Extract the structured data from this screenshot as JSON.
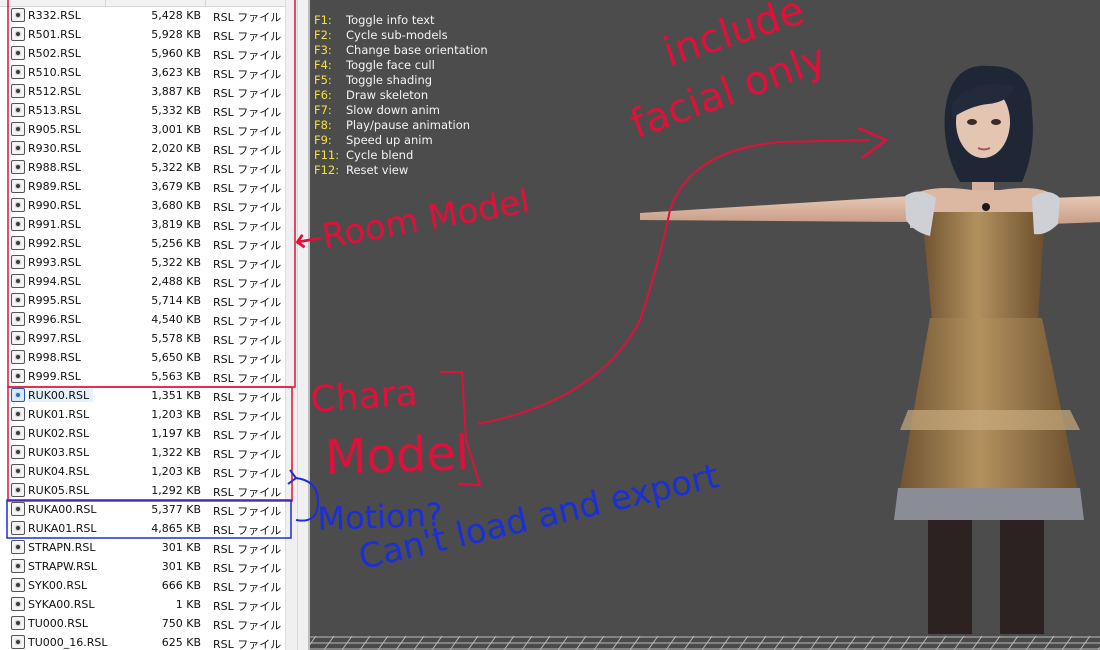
{
  "file_list": {
    "files": [
      {
        "name": "R332.RSL",
        "size": "5,428 KB",
        "type": "RSL ファイル",
        "icon": "rsl-file-icon"
      },
      {
        "name": "R501.RSL",
        "size": "5,928 KB",
        "type": "RSL ファイル",
        "icon": "rsl-file-icon"
      },
      {
        "name": "R502.RSL",
        "size": "5,960 KB",
        "type": "RSL ファイル",
        "icon": "rsl-file-icon"
      },
      {
        "name": "R510.RSL",
        "size": "3,623 KB",
        "type": "RSL ファイル",
        "icon": "rsl-file-icon"
      },
      {
        "name": "R512.RSL",
        "size": "3,887 KB",
        "type": "RSL ファイル",
        "icon": "rsl-file-icon"
      },
      {
        "name": "R513.RSL",
        "size": "5,332 KB",
        "type": "RSL ファイル",
        "icon": "rsl-file-icon"
      },
      {
        "name": "R905.RSL",
        "size": "3,001 KB",
        "type": "RSL ファイル",
        "icon": "rsl-file-icon"
      },
      {
        "name": "R930.RSL",
        "size": "2,020 KB",
        "type": "RSL ファイル",
        "icon": "rsl-file-icon"
      },
      {
        "name": "R988.RSL",
        "size": "5,322 KB",
        "type": "RSL ファイル",
        "icon": "rsl-file-icon"
      },
      {
        "name": "R989.RSL",
        "size": "3,679 KB",
        "type": "RSL ファイル",
        "icon": "rsl-file-icon"
      },
      {
        "name": "R990.RSL",
        "size": "3,680 KB",
        "type": "RSL ファイル",
        "icon": "rsl-file-icon"
      },
      {
        "name": "R991.RSL",
        "size": "3,819 KB",
        "type": "RSL ファイル",
        "icon": "rsl-file-icon"
      },
      {
        "name": "R992.RSL",
        "size": "5,256 KB",
        "type": "RSL ファイル",
        "icon": "rsl-file-icon"
      },
      {
        "name": "R993.RSL",
        "size": "5,322 KB",
        "type": "RSL ファイル",
        "icon": "rsl-file-icon"
      },
      {
        "name": "R994.RSL",
        "size": "2,488 KB",
        "type": "RSL ファイル",
        "icon": "rsl-file-icon"
      },
      {
        "name": "R995.RSL",
        "size": "5,714 KB",
        "type": "RSL ファイル",
        "icon": "rsl-file-icon"
      },
      {
        "name": "R996.RSL",
        "size": "4,540 KB",
        "type": "RSL ファイル",
        "icon": "rsl-file-icon"
      },
      {
        "name": "R997.RSL",
        "size": "5,578 KB",
        "type": "RSL ファイル",
        "icon": "rsl-file-icon"
      },
      {
        "name": "R998.RSL",
        "size": "5,650 KB",
        "type": "RSL ファイル",
        "icon": "rsl-file-icon"
      },
      {
        "name": "R999.RSL",
        "size": "5,563 KB",
        "type": "RSL ファイル",
        "icon": "rsl-file-icon"
      },
      {
        "name": "RUK00.RSL",
        "size": "1,351 KB",
        "type": "RSL ファイル",
        "icon": "rsl-file-icon-blue",
        "selected": true
      },
      {
        "name": "RUK01.RSL",
        "size": "1,203 KB",
        "type": "RSL ファイル",
        "icon": "rsl-file-icon"
      },
      {
        "name": "RUK02.RSL",
        "size": "1,197 KB",
        "type": "RSL ファイル",
        "icon": "rsl-file-icon"
      },
      {
        "name": "RUK03.RSL",
        "size": "1,322 KB",
        "type": "RSL ファイル",
        "icon": "rsl-file-icon"
      },
      {
        "name": "RUK04.RSL",
        "size": "1,203 KB",
        "type": "RSL ファイル",
        "icon": "rsl-file-icon"
      },
      {
        "name": "RUK05.RSL",
        "size": "1,292 KB",
        "type": "RSL ファイル",
        "icon": "rsl-file-icon"
      },
      {
        "name": "RUKA00.RSL",
        "size": "5,377 KB",
        "type": "RSL ファイル",
        "icon": "rsl-file-icon"
      },
      {
        "name": "RUKA01.RSL",
        "size": "4,865 KB",
        "type": "RSL ファイル",
        "icon": "rsl-file-icon"
      },
      {
        "name": "STRAPN.RSL",
        "size": "301 KB",
        "type": "RSL ファイル",
        "icon": "rsl-file-icon"
      },
      {
        "name": "STRAPW.RSL",
        "size": "301 KB",
        "type": "RSL ファイル",
        "icon": "rsl-file-icon"
      },
      {
        "name": "SYK00.RSL",
        "size": "666 KB",
        "type": "RSL ファイル",
        "icon": "rsl-file-icon"
      },
      {
        "name": "SYKA00.RSL",
        "size": "1 KB",
        "type": "RSL ファイル",
        "icon": "rsl-file-icon"
      },
      {
        "name": "TU000.RSL",
        "size": "750 KB",
        "type": "RSL ファイル",
        "icon": "rsl-file-icon"
      },
      {
        "name": "TU000_16.RSL",
        "size": "625 KB",
        "type": "RSL ファイル",
        "icon": "rsl-file-icon"
      }
    ]
  },
  "viewer": {
    "help": [
      {
        "key": "F1:",
        "desc": "Toggle info text"
      },
      {
        "key": "F2:",
        "desc": "Cycle sub-models"
      },
      {
        "key": "F3:",
        "desc": "Change base orientation"
      },
      {
        "key": "F4:",
        "desc": "Toggle face cull"
      },
      {
        "key": "F5:",
        "desc": "Toggle shading"
      },
      {
        "key": "F6:",
        "desc": "Draw skeleton"
      },
      {
        "key": "F7:",
        "desc": "Slow down anim"
      },
      {
        "key": "F8:",
        "desc": "Play/pause animation"
      },
      {
        "key": "F9:",
        "desc": "Speed up anim"
      },
      {
        "key": "F11:",
        "desc": "Cycle blend"
      },
      {
        "key": "F12:",
        "desc": "Reset view"
      }
    ],
    "colors": {
      "background": "#4c4c4c",
      "key": "#f2e23a",
      "text": "#f4f4f4"
    }
  },
  "annotations": {
    "room_model": "←Room Model",
    "include_line1": "include",
    "include_line2": "facial only",
    "chara_line1": "Chara",
    "chara_line2": "Model",
    "motion_line1": "Motion?",
    "motion_line2": "Can't load and export",
    "colors": {
      "red": "#e0103a",
      "blue": "#1a2fd8"
    }
  }
}
